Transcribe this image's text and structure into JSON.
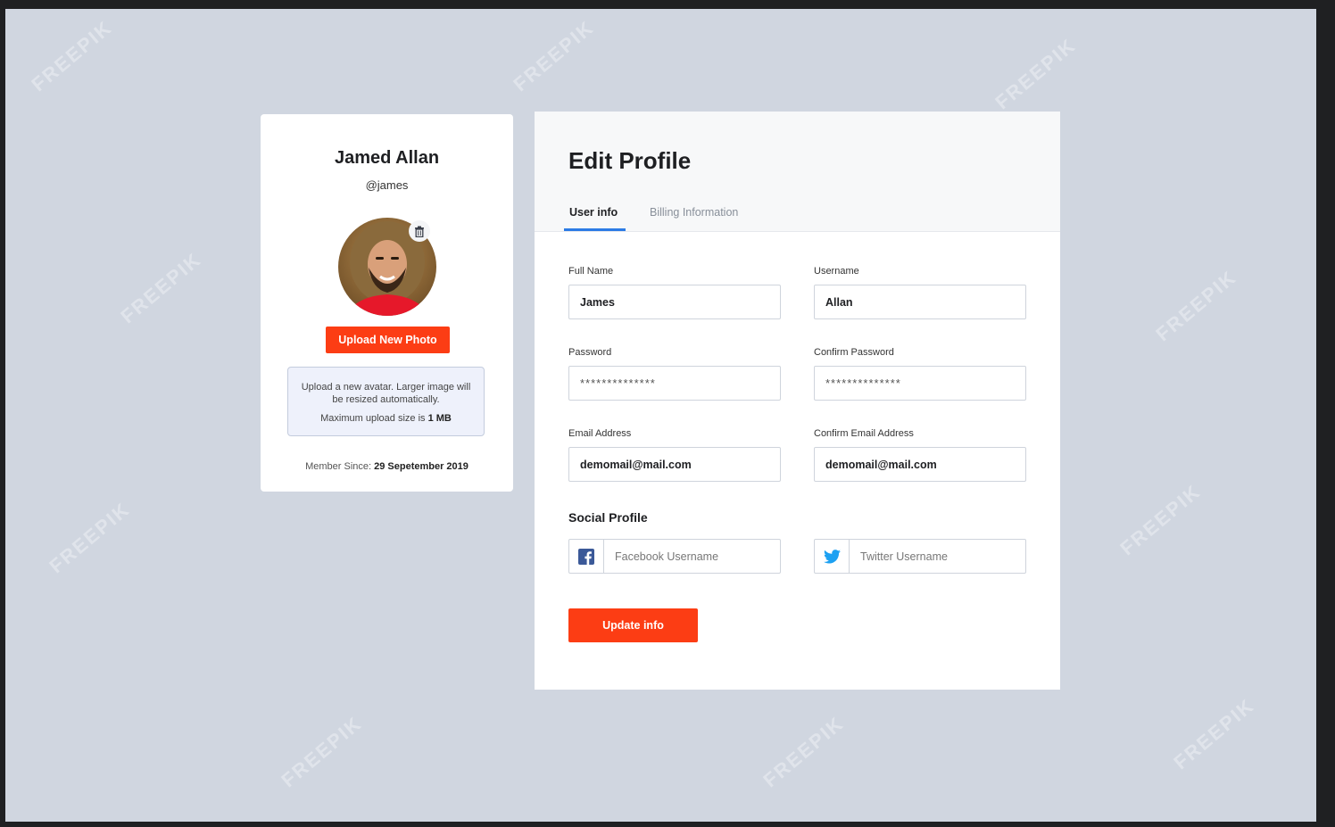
{
  "profile": {
    "name": "Jamed Allan",
    "handle": "@james",
    "upload_button": "Upload New Photo",
    "upload_info_line1": "Upload a new avatar. Larger image will be resized automatically.",
    "upload_info_line2_prefix": "Maximum upload size is ",
    "upload_info_line2_value": "1 MB",
    "member_since_label": "Member Since: ",
    "member_since_value": "29 Sepetember 2019"
  },
  "edit": {
    "title": "Edit Profile",
    "tabs": [
      {
        "label": "User info",
        "active": true
      },
      {
        "label": "Billing Information",
        "active": false
      }
    ],
    "fields": {
      "full_name": {
        "label": "Full Name",
        "value": "James"
      },
      "username": {
        "label": "Username",
        "value": "Allan"
      },
      "password": {
        "label": "Password",
        "value": "**************"
      },
      "confirm_password": {
        "label": "Confirm Password",
        "value": "**************"
      },
      "email": {
        "label": "Email Address",
        "value": "demomail@mail.com"
      },
      "confirm_email": {
        "label": "Confirm Email Address",
        "value": "demomail@mail.com"
      }
    },
    "social_title": "Social Profile",
    "facebook_placeholder": "Facebook Username",
    "twitter_placeholder": "Twitter Username",
    "update_button": "Update info"
  },
  "watermark": "FREEPIK",
  "colors": {
    "accent": "#fc3d14",
    "tab_active": "#2c7be5",
    "background": "#d0d6e0",
    "facebook": "#3b5998",
    "twitter": "#1da1f2"
  }
}
